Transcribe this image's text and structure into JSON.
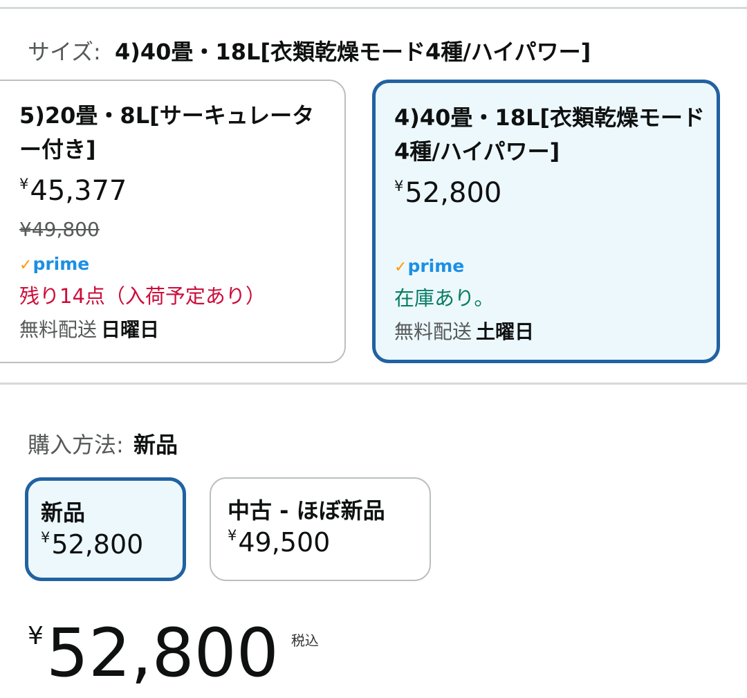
{
  "size_section": {
    "label": "サイズ:",
    "selected_value": "4)40畳・18L[衣類乾燥モード4種/ハイパワー]",
    "options": [
      {
        "title": "5)20畳・8L[サーキュレーター付き]",
        "currency": "¥",
        "price": "45,377",
        "list_price": "¥49,800",
        "prime": "prime",
        "stock": "残り14点（入荷予定あり）",
        "shipping_label": "無料配送",
        "delivery_day": "日曜日",
        "selected": false
      },
      {
        "title": "4)40畳・18L[衣類乾燥モード4種/ハイパワー]",
        "currency": "¥",
        "price": "52,800",
        "prime": "prime",
        "stock": "在庫あり。",
        "shipping_label": "無料配送",
        "delivery_day": "土曜日",
        "selected": true
      }
    ]
  },
  "purchase_section": {
    "label": "購入方法:",
    "selected_value": "新品",
    "options": [
      {
        "title": "新品",
        "currency": "¥",
        "price": "52,800",
        "selected": true
      },
      {
        "title": "中古 - ほぼ新品",
        "currency": "¥",
        "price": "49,500",
        "selected": false
      }
    ]
  },
  "total": {
    "currency": "¥",
    "price": "52,800",
    "tax_note": "税込"
  },
  "colors": {
    "selected_border": "#2162a1",
    "selected_bg": "#edf8fd",
    "low_stock": "#cc0c39",
    "in_stock": "#067d62",
    "prime_blue": "#1c8fe3",
    "prime_check": "#ff9900"
  }
}
